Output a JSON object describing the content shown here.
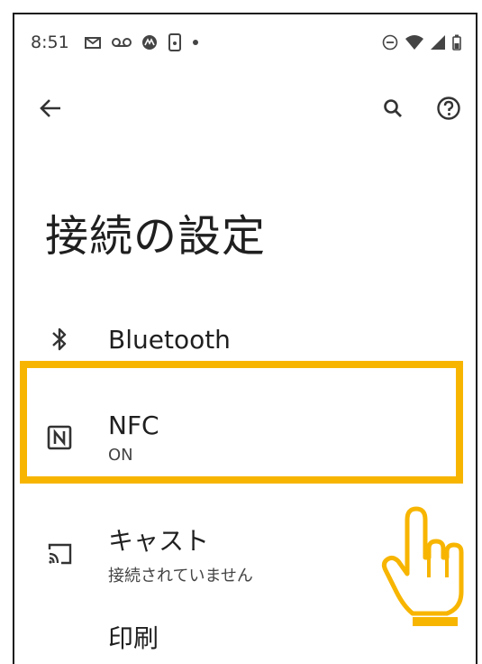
{
  "status_bar": {
    "time": "8:51",
    "notification_icons": [
      "mail-icon",
      "voicemail-icon",
      "motorola-icon",
      "nfc-phone-icon",
      "dot-icon"
    ],
    "system_icons": [
      "do-not-disturb-icon",
      "wifi-icon",
      "signal-icon",
      "battery-icon"
    ]
  },
  "app_bar": {
    "back_icon": "back-arrow-icon",
    "search_icon": "search-icon",
    "help_icon": "help-icon"
  },
  "page": {
    "title": "接続の設定"
  },
  "settings": [
    {
      "id": "bluetooth",
      "icon": "bluetooth-icon",
      "title": "Bluetooth",
      "summary": ""
    },
    {
      "id": "nfc",
      "icon": "nfc-icon",
      "title": "NFC",
      "summary": "ON"
    },
    {
      "id": "cast",
      "icon": "cast-icon",
      "title": "キャスト",
      "summary": "接続されていません"
    },
    {
      "id": "print",
      "icon": "print-icon",
      "title": "印刷",
      "summary": ""
    }
  ],
  "colors": {
    "highlight": "#f7b500",
    "hand_fill": "#ffffff",
    "hand_stroke": "#f7b500"
  }
}
